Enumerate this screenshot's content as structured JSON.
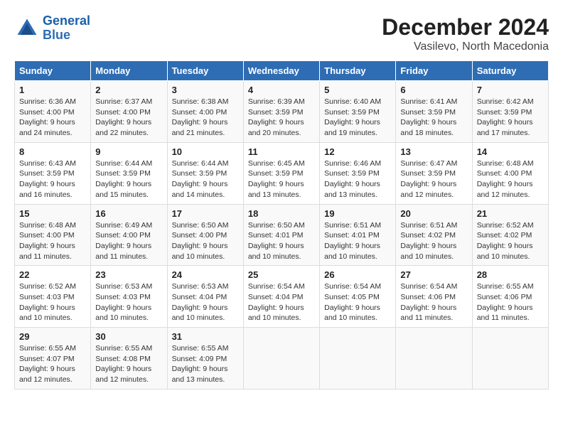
{
  "header": {
    "logo_line1": "General",
    "logo_line2": "Blue",
    "main_title": "December 2024",
    "sub_title": "Vasilevo, North Macedonia"
  },
  "weekdays": [
    "Sunday",
    "Monday",
    "Tuesday",
    "Wednesday",
    "Thursday",
    "Friday",
    "Saturday"
  ],
  "weeks": [
    [
      {
        "day": "1",
        "sunrise": "6:36 AM",
        "sunset": "4:00 PM",
        "daylight": "9 hours and 24 minutes."
      },
      {
        "day": "2",
        "sunrise": "6:37 AM",
        "sunset": "4:00 PM",
        "daylight": "9 hours and 22 minutes."
      },
      {
        "day": "3",
        "sunrise": "6:38 AM",
        "sunset": "4:00 PM",
        "daylight": "9 hours and 21 minutes."
      },
      {
        "day": "4",
        "sunrise": "6:39 AM",
        "sunset": "3:59 PM",
        "daylight": "9 hours and 20 minutes."
      },
      {
        "day": "5",
        "sunrise": "6:40 AM",
        "sunset": "3:59 PM",
        "daylight": "9 hours and 19 minutes."
      },
      {
        "day": "6",
        "sunrise": "6:41 AM",
        "sunset": "3:59 PM",
        "daylight": "9 hours and 18 minutes."
      },
      {
        "day": "7",
        "sunrise": "6:42 AM",
        "sunset": "3:59 PM",
        "daylight": "9 hours and 17 minutes."
      }
    ],
    [
      {
        "day": "8",
        "sunrise": "6:43 AM",
        "sunset": "3:59 PM",
        "daylight": "9 hours and 16 minutes."
      },
      {
        "day": "9",
        "sunrise": "6:44 AM",
        "sunset": "3:59 PM",
        "daylight": "9 hours and 15 minutes."
      },
      {
        "day": "10",
        "sunrise": "6:44 AM",
        "sunset": "3:59 PM",
        "daylight": "9 hours and 14 minutes."
      },
      {
        "day": "11",
        "sunrise": "6:45 AM",
        "sunset": "3:59 PM",
        "daylight": "9 hours and 13 minutes."
      },
      {
        "day": "12",
        "sunrise": "6:46 AM",
        "sunset": "3:59 PM",
        "daylight": "9 hours and 13 minutes."
      },
      {
        "day": "13",
        "sunrise": "6:47 AM",
        "sunset": "3:59 PM",
        "daylight": "9 hours and 12 minutes."
      },
      {
        "day": "14",
        "sunrise": "6:48 AM",
        "sunset": "4:00 PM",
        "daylight": "9 hours and 12 minutes."
      }
    ],
    [
      {
        "day": "15",
        "sunrise": "6:48 AM",
        "sunset": "4:00 PM",
        "daylight": "9 hours and 11 minutes."
      },
      {
        "day": "16",
        "sunrise": "6:49 AM",
        "sunset": "4:00 PM",
        "daylight": "9 hours and 11 minutes."
      },
      {
        "day": "17",
        "sunrise": "6:50 AM",
        "sunset": "4:00 PM",
        "daylight": "9 hours and 10 minutes."
      },
      {
        "day": "18",
        "sunrise": "6:50 AM",
        "sunset": "4:01 PM",
        "daylight": "9 hours and 10 minutes."
      },
      {
        "day": "19",
        "sunrise": "6:51 AM",
        "sunset": "4:01 PM",
        "daylight": "9 hours and 10 minutes."
      },
      {
        "day": "20",
        "sunrise": "6:51 AM",
        "sunset": "4:02 PM",
        "daylight": "9 hours and 10 minutes."
      },
      {
        "day": "21",
        "sunrise": "6:52 AM",
        "sunset": "4:02 PM",
        "daylight": "9 hours and 10 minutes."
      }
    ],
    [
      {
        "day": "22",
        "sunrise": "6:52 AM",
        "sunset": "4:03 PM",
        "daylight": "9 hours and 10 minutes."
      },
      {
        "day": "23",
        "sunrise": "6:53 AM",
        "sunset": "4:03 PM",
        "daylight": "9 hours and 10 minutes."
      },
      {
        "day": "24",
        "sunrise": "6:53 AM",
        "sunset": "4:04 PM",
        "daylight": "9 hours and 10 minutes."
      },
      {
        "day": "25",
        "sunrise": "6:54 AM",
        "sunset": "4:04 PM",
        "daylight": "9 hours and 10 minutes."
      },
      {
        "day": "26",
        "sunrise": "6:54 AM",
        "sunset": "4:05 PM",
        "daylight": "9 hours and 10 minutes."
      },
      {
        "day": "27",
        "sunrise": "6:54 AM",
        "sunset": "4:06 PM",
        "daylight": "9 hours and 11 minutes."
      },
      {
        "day": "28",
        "sunrise": "6:55 AM",
        "sunset": "4:06 PM",
        "daylight": "9 hours and 11 minutes."
      }
    ],
    [
      {
        "day": "29",
        "sunrise": "6:55 AM",
        "sunset": "4:07 PM",
        "daylight": "9 hours and 12 minutes."
      },
      {
        "day": "30",
        "sunrise": "6:55 AM",
        "sunset": "4:08 PM",
        "daylight": "9 hours and 12 minutes."
      },
      {
        "day": "31",
        "sunrise": "6:55 AM",
        "sunset": "4:09 PM",
        "daylight": "9 hours and 13 minutes."
      },
      null,
      null,
      null,
      null
    ]
  ]
}
